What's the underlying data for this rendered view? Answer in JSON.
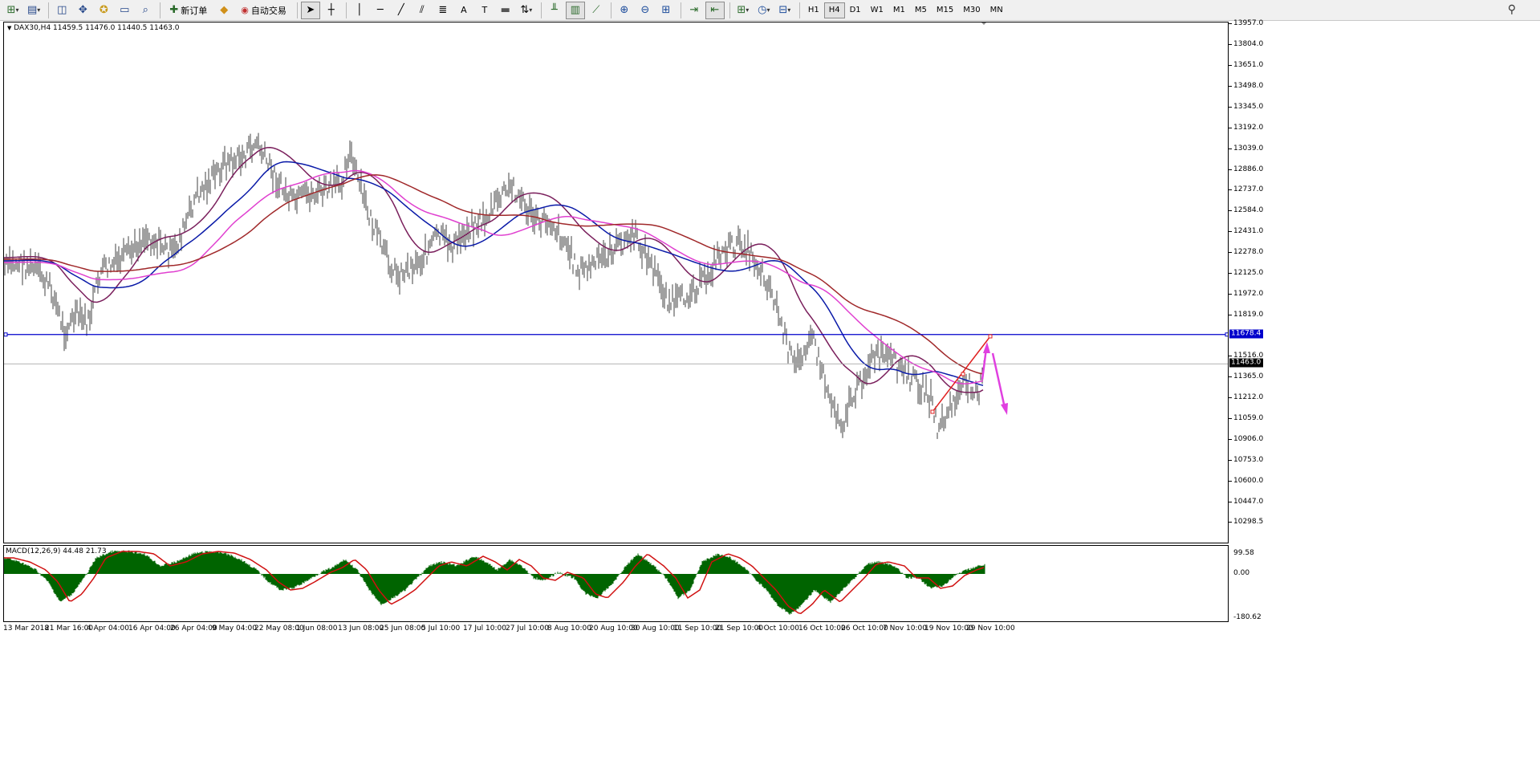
{
  "toolbar": {
    "new_order_label": "新订单",
    "auto_trade_label": "自动交易",
    "timeframes": [
      "H1",
      "H4",
      "D1",
      "W1",
      "M1",
      "M5",
      "M15",
      "M30",
      "MN"
    ],
    "active_timeframe": "H4"
  },
  "chart": {
    "symbol_header": "DAX30,H4  11459.5 11476.0 11440.5 11463.0",
    "price_levels": [
      "13957.0",
      "13804.0",
      "13651.0",
      "13498.0",
      "13345.0",
      "13192.0",
      "13039.0",
      "12886.0",
      "12737.0",
      "12584.0",
      "12431.0",
      "12278.0",
      "12125.0",
      "11972.0",
      "11819.0",
      "11516.0",
      "11365.0",
      "11212.0",
      "11059.0",
      "10906.0",
      "10753.0",
      "10600.0",
      "10447.0",
      "10298.5"
    ],
    "hline_price_label": "11678.4",
    "current_price_label": "11463.0",
    "time_labels": [
      "13 Mar 2018",
      "21 Mar 16:00",
      "4 Apr 04:00",
      "16 Apr 04:00",
      "26 Apr 04:00",
      "9 May 04:00",
      "22 May 08:00",
      "1 Jun 08:00",
      "13 Jun 08:00",
      "25 Jun 08:00",
      "5 Jul 10:00",
      "17 Jul 10:00",
      "27 Jul 10:00",
      "8 Aug 10:00",
      "20 Aug 10:00",
      "30 Aug 10:00",
      "11 Sep 10:00",
      "21 Sep 10:00",
      "4 Oct 10:00",
      "16 Oct 10:00",
      "26 Oct 10:00",
      "7 Nov 10:00",
      "19 Nov 10:00",
      "29 Nov 10:00"
    ],
    "colors": {
      "hline": "#0000cc",
      "ma_fast": "#7a1f5c",
      "ma_mid": "#0a1aa8",
      "ma_slow": "#e040d0",
      "ma_slowest": "#a0282a",
      "arrow": "#e040e0",
      "trendline": "#e02020",
      "bars": "#404040"
    }
  },
  "macd": {
    "header": "MACD(12,26,9) 44.48 21.73",
    "levels": [
      "99.58",
      "0.00",
      "-180.62"
    ],
    "colors": {
      "histogram": "#006400",
      "signal": "#d01010"
    }
  }
}
